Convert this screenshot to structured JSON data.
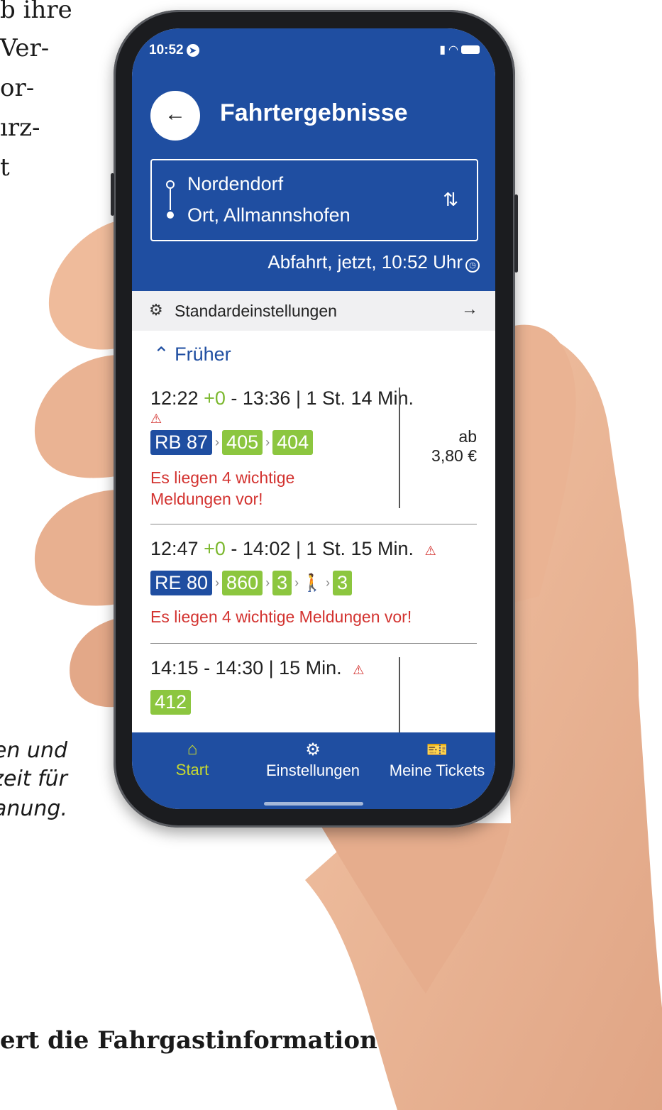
{
  "background_text": {
    "lines": [
      "b ihre",
      " Ver-",
      "or-",
      "ırz-",
      "t"
    ],
    "italic_lines": [
      "en und",
      "zeit für",
      "anung."
    ],
    "bold_line": "ert die Fahrgastinformation"
  },
  "status_bar": {
    "time": "10:52"
  },
  "header": {
    "back_label": "←",
    "title": "Fahrtergebnisse",
    "from": "Nordendorf",
    "to": "Ort, Allmannshofen",
    "departure": "Abfahrt, jetzt, 10:52 Uhr"
  },
  "settings": {
    "label": "Standardeinstellungen",
    "arrow": "→"
  },
  "earlier": {
    "label": "Früher"
  },
  "connections": [
    {
      "start": "12:22",
      "delay": "+0",
      "rest": " - 13:36 | 1 St. 14 Min.",
      "lines": [
        "RB 87",
        "405",
        "404"
      ],
      "message": "Es liegen 4 wichtige Meldungen vor!",
      "price_prefix": "ab",
      "price": "3,80 €"
    },
    {
      "start": "12:47",
      "delay": "+0",
      "rest": " - 14:02 | 1 St. 15 Min.",
      "lines": [
        "RE 80",
        "860",
        "3",
        "3"
      ],
      "message": "Es liegen 4 wichtige Meldungen vor!"
    },
    {
      "times": "14:15 - 14:30 | 15 Min.",
      "lines": [
        "412"
      ]
    }
  ],
  "nav": {
    "start": "Start",
    "settings": "Einstellungen",
    "tickets": "Meine Tickets"
  },
  "colors": {
    "primary_blue": "#1f4ea1",
    "bus_green": "#8cc63f",
    "delay_green": "#7cb82f",
    "alert_red": "#d3322f",
    "active_nav": "#c7d92f"
  }
}
